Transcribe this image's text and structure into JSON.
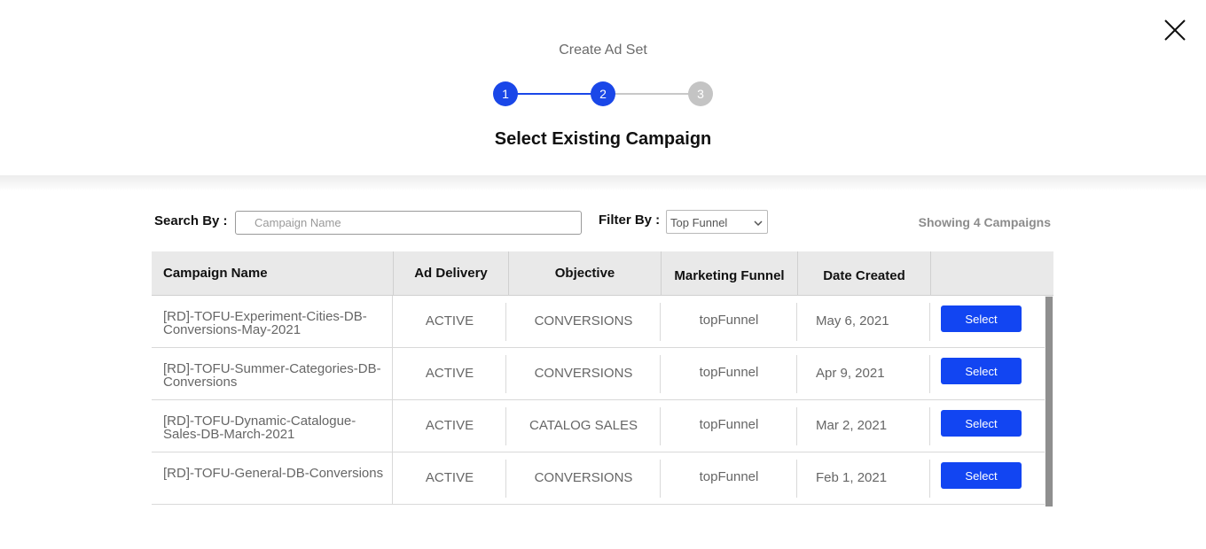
{
  "modal": {
    "title": "Create Ad Set",
    "step_heading": "Select Existing Campaign",
    "steps": [
      "1",
      "2",
      "3"
    ],
    "current_step": 2,
    "close_icon": "close-icon"
  },
  "toolbar": {
    "search_label": "Search By :",
    "search_placeholder": "Campaign Name",
    "search_value": "",
    "filter_label": "Filter By :",
    "filter_value": "Top Funnel",
    "showing_text": "Showing 4 Campaigns"
  },
  "table": {
    "columns": [
      "Campaign Name",
      "Ad Delivery",
      "Objective",
      "Marketing Funnel",
      "Date Created",
      ""
    ],
    "rows": [
      {
        "name": "[RD]-TOFU-Experiment-Cities-DB-Conversions-May-2021",
        "delivery": "ACTIVE",
        "objective": "CONVERSIONS",
        "funnel": "topFunnel",
        "date": "May 6, 2021",
        "action": "Select"
      },
      {
        "name": "[RD]-TOFU-Summer-Categories-DB-Conversions",
        "delivery": "ACTIVE",
        "objective": "CONVERSIONS",
        "funnel": "topFunnel",
        "date": "Apr 9, 2021",
        "action": "Select"
      },
      {
        "name": "[RD]-TOFU-Dynamic-Catalogue-Sales-DB-March-2021",
        "delivery": "ACTIVE",
        "objective": "CATALOG SALES",
        "funnel": "topFunnel",
        "date": "Mar 2, 2021",
        "action": "Select"
      },
      {
        "name": "[RD]-TOFU-General-DB-Conversions",
        "delivery": "ACTIVE",
        "objective": "CONVERSIONS",
        "funnel": "topFunnel",
        "date": "Feb 1, 2021",
        "action": "Select"
      }
    ]
  },
  "colors": {
    "accent": "#1245f2",
    "step_active": "#1a47e8",
    "step_inactive": "#c4c4c4"
  }
}
